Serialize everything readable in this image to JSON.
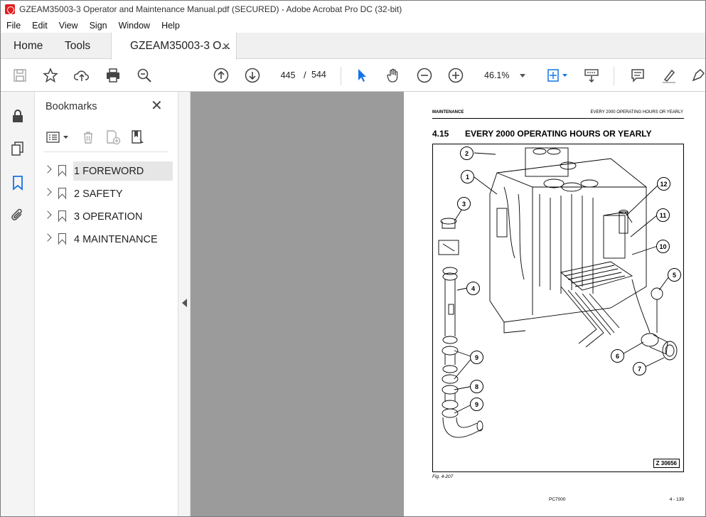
{
  "window": {
    "title": "GZEAM35003-3 Operator and Maintenance Manual.pdf (SECURED) - Adobe Acrobat Pro DC (32-bit)"
  },
  "menu": [
    "File",
    "Edit",
    "View",
    "Sign",
    "Window",
    "Help"
  ],
  "tabs": {
    "home": "Home",
    "tools": "Tools",
    "document": "GZEAM35003-3 O..."
  },
  "toolbar": {
    "current_page": "445",
    "page_separator": "/",
    "total_pages": "544",
    "zoom": "46.1%"
  },
  "bookmarks": {
    "title": "Bookmarks",
    "items": [
      {
        "label": "1 FOREWORD",
        "selected": true
      },
      {
        "label": "2 SAFETY",
        "selected": false
      },
      {
        "label": "3 OPERATION",
        "selected": false
      },
      {
        "label": "4 MAINTENANCE",
        "selected": false
      }
    ]
  },
  "page": {
    "header_left": "MAINTENANCE",
    "header_right": "EVERY 2000 OPERATING HOURS OR YEARLY",
    "section_number": "4.15",
    "section_title": "EVERY 2000 OPERATING HOURS OR YEARLY",
    "figure_code": "Z 30656",
    "figure_caption": "Fig. 4-207",
    "footer_model": "PC7000",
    "footer_page": "4 - 139",
    "callouts": [
      "2",
      "1",
      "3",
      "4",
      "9",
      "8",
      "9",
      "12",
      "11",
      "10",
      "5",
      "6",
      "7"
    ]
  }
}
